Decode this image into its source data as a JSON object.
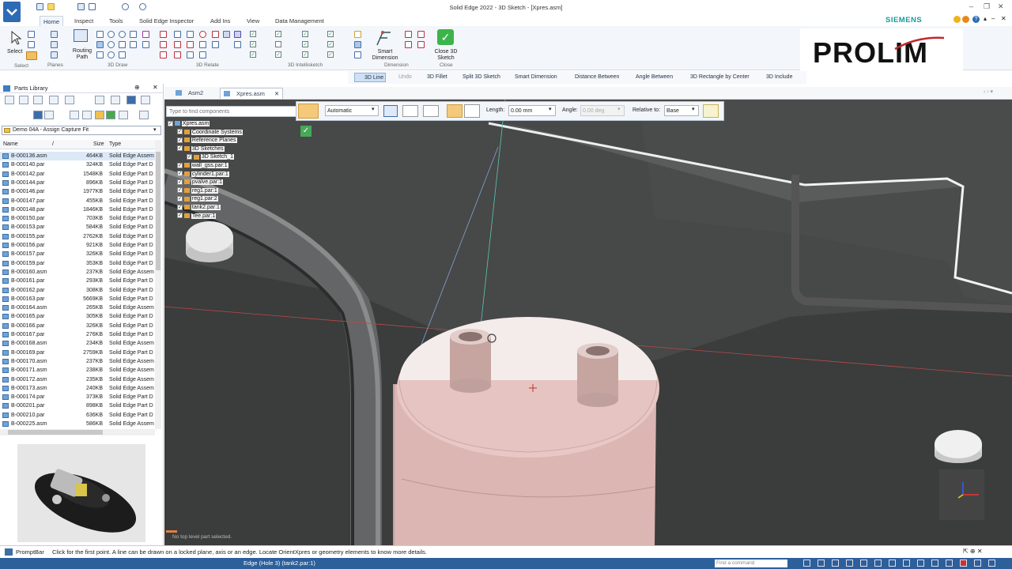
{
  "window": {
    "title": "Solid Edge 2022 - 3D Sketch - [Xpres.asm]",
    "brand": "SIEMENS"
  },
  "ribbon": {
    "tabs": [
      "Home",
      "Inspect",
      "Tools",
      "Solid Edge Inspector",
      "Add Ins",
      "View",
      "Data Management"
    ],
    "active_tab": "Home",
    "groups": {
      "select": "Select",
      "select_btn": "Select",
      "planes": "Planes",
      "routing_path": "Routing Path",
      "draw_3d": "3D Draw",
      "relate_3d": "3D Relate",
      "intellisketch_3d": "3D Intellisketch",
      "smart_dimension": "Smart Dimension",
      "dimension": "Dimension",
      "close_3d_sketch": "Close 3D Sketch",
      "close": "Close"
    }
  },
  "logo": {
    "text": "PROLIM"
  },
  "command_bar": {
    "items": [
      "3D Line",
      "Undo",
      "3D Fillet",
      "Split 3D Sketch",
      "Smart Dimension",
      "Distance Between",
      "Angle Between",
      "3D Rectangle by Center",
      "3D Include"
    ]
  },
  "parts_library": {
    "title": "Parts Library",
    "folder": "Demo 04A - Assign Capture Fit",
    "columns": {
      "name": "Name",
      "size": "Size",
      "type": "Type"
    },
    "rows": [
      [
        "B-000136.asm",
        "464KB",
        "Solid Edge Assem"
      ],
      [
        "B-000140.par",
        "324KB",
        "Solid Edge Part D"
      ],
      [
        "B-000142.par",
        "1548KB",
        "Solid Edge Part D"
      ],
      [
        "B-000144.par",
        "896KB",
        "Solid Edge Part D"
      ],
      [
        "B-000146.par",
        "1977KB",
        "Solid Edge Part D"
      ],
      [
        "B-000147.par",
        "455KB",
        "Solid Edge Part D"
      ],
      [
        "B-000148.par",
        "1846KB",
        "Solid Edge Part D"
      ],
      [
        "B-000150.par",
        "703KB",
        "Solid Edge Part D"
      ],
      [
        "B-000153.par",
        "584KB",
        "Solid Edge Part D"
      ],
      [
        "B-000155.par",
        "2762KB",
        "Solid Edge Part D"
      ],
      [
        "B-000156.par",
        "921KB",
        "Solid Edge Part D"
      ],
      [
        "B-000157.par",
        "326KB",
        "Solid Edge Part D"
      ],
      [
        "B-000159.par",
        "353KB",
        "Solid Edge Part D"
      ],
      [
        "B-000160.asm",
        "237KB",
        "Solid Edge Assem"
      ],
      [
        "B-000161.par",
        "293KB",
        "Solid Edge Part D"
      ],
      [
        "B-000162.par",
        "308KB",
        "Solid Edge Part D"
      ],
      [
        "B-000163.par",
        "5669KB",
        "Solid Edge Part D"
      ],
      [
        "B-000164.asm",
        "265KB",
        "Solid Edge Assem"
      ],
      [
        "B-000165.par",
        "305KB",
        "Solid Edge Part D"
      ],
      [
        "B-000166.par",
        "326KB",
        "Solid Edge Part D"
      ],
      [
        "B-000167.par",
        "276KB",
        "Solid Edge Part D"
      ],
      [
        "B-000168.asm",
        "234KB",
        "Solid Edge Assem"
      ],
      [
        "B-000169.par",
        "2759KB",
        "Solid Edge Part D"
      ],
      [
        "B-000170.asm",
        "237KB",
        "Solid Edge Assem"
      ],
      [
        "B-000171.asm",
        "238KB",
        "Solid Edge Assem"
      ],
      [
        "B-000172.asm",
        "235KB",
        "Solid Edge Assem"
      ],
      [
        "B-000173.asm",
        "240KB",
        "Solid Edge Assem"
      ],
      [
        "B-000174.par",
        "373KB",
        "Solid Edge Part D"
      ],
      [
        "B-000201.par",
        "898KB",
        "Solid Edge Part D"
      ],
      [
        "B-000210.par",
        "636KB",
        "Solid Edge Part D"
      ],
      [
        "B-000225.asm",
        "586KB",
        "Solid Edge Assem"
      ]
    ]
  },
  "doc_tabs": [
    "Asm2",
    "Xpres.asm"
  ],
  "active_doc": "Xpres.asm",
  "find_placeholder": "Type to find components",
  "line_toolbar": {
    "mode": "Automatic",
    "length_label": "Length:",
    "length_value": "0.00 mm",
    "angle_label": "Angle:",
    "angle_value": "0.00 deg",
    "relative_label": "Relative to:",
    "relative_value": "Base"
  },
  "tree": [
    {
      "label": "Xpres.asm",
      "level": 0
    },
    {
      "label": "Coordinate Systems",
      "level": 1
    },
    {
      "label": "Reference Planes",
      "level": 1
    },
    {
      "label": "3D Sketches",
      "level": 1
    },
    {
      "label": "3D Sketch_1",
      "level": 2
    },
    {
      "label": "wall_gss.par:1",
      "level": 1
    },
    {
      "label": "cylinder1.par:1",
      "level": 1
    },
    {
      "label": "pvalve.par:1",
      "level": 1
    },
    {
      "label": "reg1.par:1",
      "level": 1
    },
    {
      "label": "reg1.par:2",
      "level": 1
    },
    {
      "label": "tank2.par:1",
      "level": 1
    },
    {
      "label": "Tee.par:1",
      "level": 1
    }
  ],
  "viewport_msg": "No top level part selected.",
  "status": {
    "promptbar": "PromptBar",
    "prompt": "Click for the first point. A line can be drawn on a locked plane, axis or an edge. Locate OrientXpres or geometry elements to know more details.",
    "selection": "Edge (Hole 3) (tank2.par:1)",
    "find_command": "Find a command"
  },
  "colors": {
    "accent": "#2d5f9a",
    "part": "#e8c7c4",
    "background": "#3b3c3c"
  }
}
